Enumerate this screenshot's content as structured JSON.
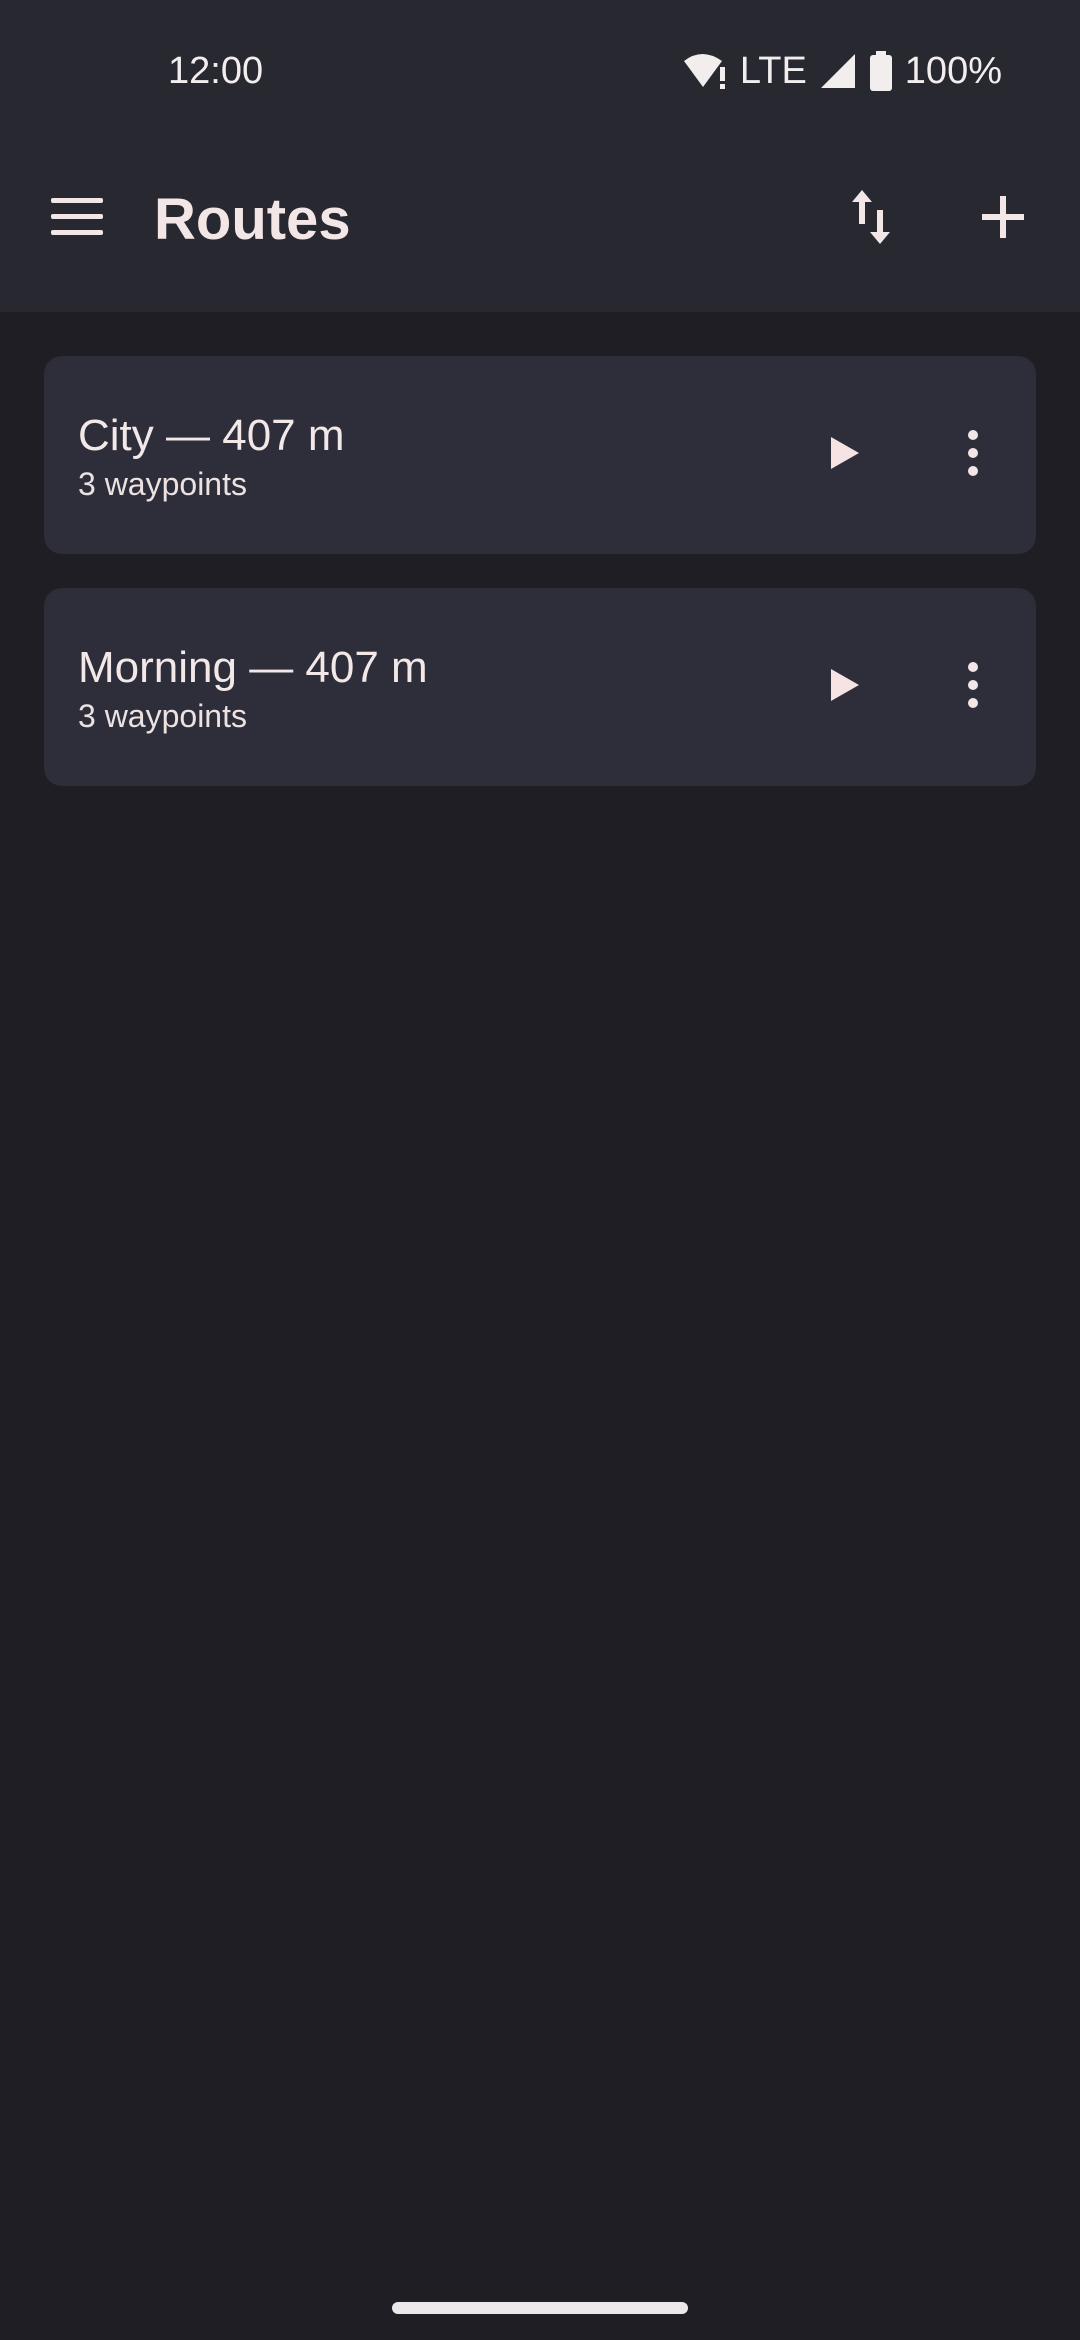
{
  "status_bar": {
    "time": "12:00",
    "network": "LTE",
    "battery": "100%",
    "icons": [
      "wifi-alert-icon",
      "signal-icon",
      "battery-icon"
    ]
  },
  "app_bar": {
    "title": "Routes",
    "icons": [
      "menu-icon",
      "sort-icon",
      "add-icon"
    ]
  },
  "routes": [
    {
      "title": "City — 407 m",
      "subtitle": "3 waypoints"
    },
    {
      "title": "Morning — 407 m",
      "subtitle": "3 waypoints"
    }
  ],
  "colors": {
    "background": "#1f1e24",
    "bar": "#282831",
    "card": "#2e2d3a",
    "text": "#f3e7e7"
  }
}
